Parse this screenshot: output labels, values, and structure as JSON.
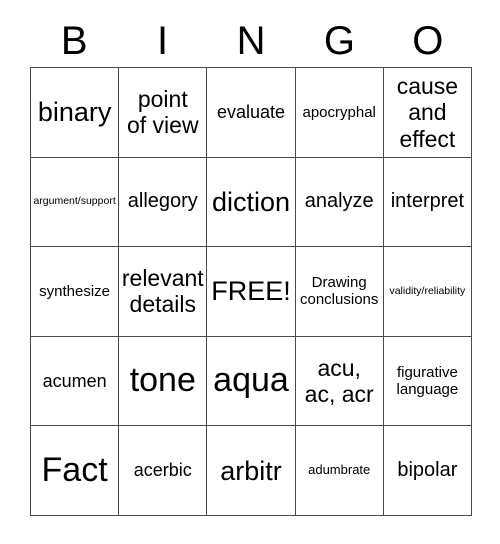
{
  "header": {
    "letters": [
      "B",
      "I",
      "N",
      "G",
      "O"
    ]
  },
  "grid": {
    "columns": 5,
    "rows": 5,
    "border_color": "#4a4a4a",
    "background_color": "#ffffff",
    "text_color": "#000000"
  },
  "cells": [
    {
      "text": "binary",
      "size": "xl"
    },
    {
      "text": "point\nof view",
      "size": "l"
    },
    {
      "text": "evaluate",
      "size": "m"
    },
    {
      "text": "apocryphal",
      "size": "s"
    },
    {
      "text": "cause\nand\neffect",
      "size": "l"
    },
    {
      "text": "argument/support",
      "size": "xxs"
    },
    {
      "text": "allegory",
      "size": "ml"
    },
    {
      "text": "diction",
      "size": "xl"
    },
    {
      "text": "analyze",
      "size": "ml"
    },
    {
      "text": "interpret",
      "size": "ml"
    },
    {
      "text": "synthesize",
      "size": "s"
    },
    {
      "text": "relevant\ndetails",
      "size": "l"
    },
    {
      "text": "FREE!",
      "size": "xl"
    },
    {
      "text": "Drawing\nconclusions",
      "size": "s"
    },
    {
      "text": "validity/reliability",
      "size": "xxs"
    },
    {
      "text": "acumen",
      "size": "m"
    },
    {
      "text": "tone",
      "size": "xxl"
    },
    {
      "text": "aqua",
      "size": "xxl"
    },
    {
      "text": "acu,\nac, acr",
      "size": "l"
    },
    {
      "text": "figurative\nlanguage",
      "size": "s"
    },
    {
      "text": "Fact",
      "size": "xxl"
    },
    {
      "text": "acerbic",
      "size": "m"
    },
    {
      "text": "arbitr",
      "size": "xl"
    },
    {
      "text": "adumbrate",
      "size": "xs"
    },
    {
      "text": "bipolar",
      "size": "ml"
    }
  ]
}
